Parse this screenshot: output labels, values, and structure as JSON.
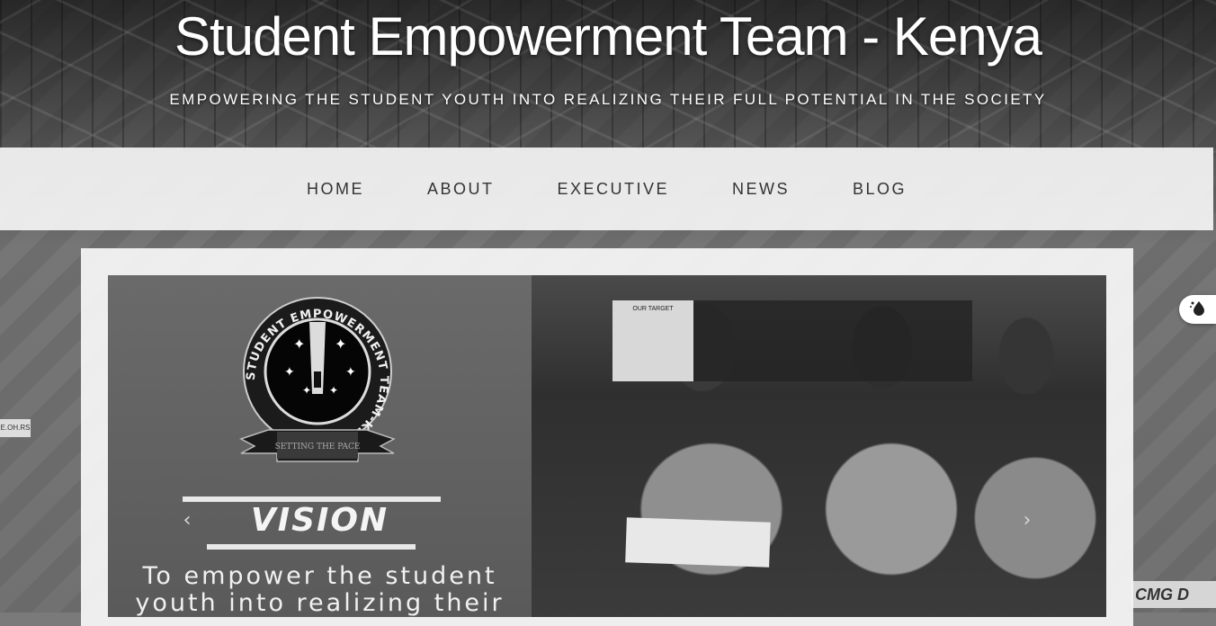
{
  "header": {
    "site_title": "Student Empowerment Team - Kenya",
    "tagline": "EMPOWERING THE STUDENT YOUTH INTO REALIZING THEIR FULL POTENTIAL IN THE SOCIETY"
  },
  "nav": {
    "items": [
      {
        "label": "HOME"
      },
      {
        "label": "ABOUT"
      },
      {
        "label": "EXECUTIVE"
      },
      {
        "label": "NEWS"
      },
      {
        "label": "BLOG"
      }
    ]
  },
  "slider": {
    "logo": {
      "ring_text": "STUDENT EMPOWERMENT TEAM-KENYA",
      "ribbon_text": "SETTING THE PACE"
    },
    "heading": "VISION",
    "text_line1": "To empower the student",
    "text_line2": "youth into realizing their",
    "prev_arrow": "‹",
    "next_arrow": "›",
    "photo_notice_text": "OUR TARGET"
  },
  "background_signs": {
    "left_sign": "E.OH.RS",
    "right_sign": "CMG D"
  },
  "widget": {
    "icon": "color-drop-icon"
  },
  "colors": {
    "nav_bg": "#f4f4f4",
    "nav_text": "#333333",
    "title_text": "#ffffff",
    "panel_bg": "#f5f5f5"
  }
}
